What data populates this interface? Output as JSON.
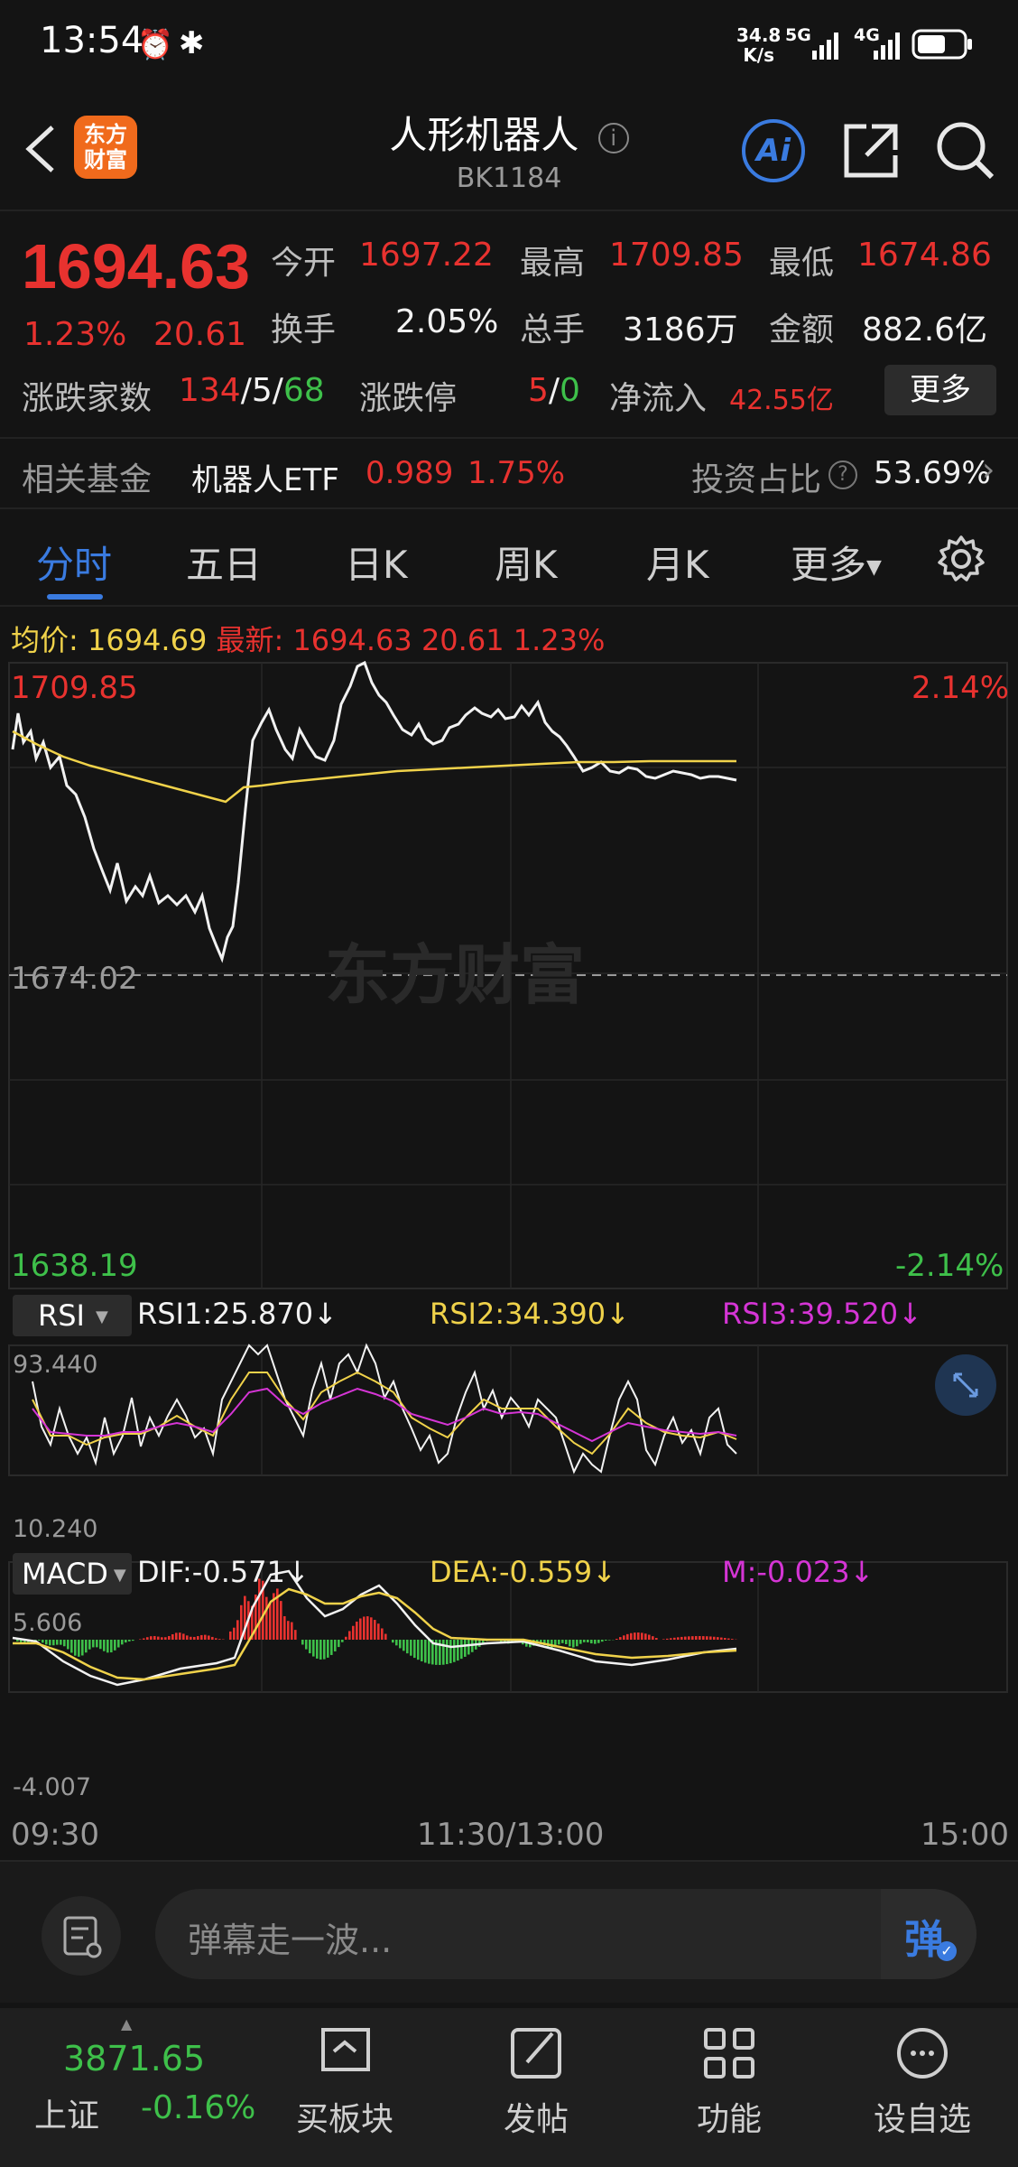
{
  "status_bar": {
    "time": "13:54",
    "speed_value": "34.8",
    "speed_unit": "K/s",
    "network1": "5G",
    "network2": "4G"
  },
  "header": {
    "logo_text_line1": "东方",
    "logo_text_line2": "财富",
    "title": "人形机器人",
    "code": "BK1184",
    "ai_label": "Ai"
  },
  "quote": {
    "price": "1694.63",
    "change_pct": "1.23%",
    "change_amt": "20.61",
    "open_label": "今开",
    "open_value": "1697.22",
    "high_label": "最高",
    "high_value": "1709.85",
    "low_label": "最低",
    "low_value": "1674.86",
    "turnover_label": "换手",
    "turnover_value": "2.05%",
    "volume_label": "总手",
    "volume_value": "3186万",
    "amount_label": "金额",
    "amount_value": "882.6亿",
    "updown_label": "涨跌家数",
    "up_count": "134",
    "flat_count": "5",
    "down_count": "68",
    "limit_label": "涨跌停",
    "limit_up": "5",
    "limit_down": "0",
    "inflow_label": "净流入",
    "inflow_value": "42.55亿",
    "more_button": "更多"
  },
  "fund": {
    "label": "相关基金",
    "name": "机器人ETF",
    "price": "0.989",
    "change": "1.75%",
    "ratio_label": "投资占比",
    "ratio_value": "53.69%"
  },
  "tabs": [
    "分时",
    "五日",
    "日K",
    "周K",
    "月K",
    "更多"
  ],
  "chart_info": {
    "avg_label": "均价:",
    "avg_value": "1694.69",
    "latest_label": "最新:",
    "latest_value": "1694.63",
    "latest_change": "20.61",
    "latest_pct": "1.23%",
    "y_top": "1709.85",
    "y_mid": "1674.02",
    "y_bottom": "1638.19",
    "pct_top": "2.14%",
    "pct_bottom": "-2.14%",
    "watermark": "东方财富"
  },
  "rsi": {
    "selector": "RSI",
    "rsi1": "RSI1:25.870↓",
    "rsi2": "RSI2:34.390↓",
    "rsi3": "RSI3:39.520↓",
    "y_top": "93.440",
    "y_bottom": "10.240"
  },
  "macd": {
    "selector": "MACD",
    "dif": "DIF:-0.571↓",
    "dea": "DEA:-0.559↓",
    "m": "M:-0.023↓",
    "y_top": "5.606",
    "y_bottom": "-4.007"
  },
  "time_axis": {
    "start": "09:30",
    "mid": "11:30/13:00",
    "end": "15:00"
  },
  "comment": {
    "placeholder": "弹幕走一波...",
    "danmu_label": "弹"
  },
  "bottom_nav": {
    "index_value": "3871.65",
    "index_name": "上证",
    "index_change": "-0.16%",
    "items": [
      "买板块",
      "发帖",
      "功能",
      "设自选"
    ]
  },
  "colors": {
    "up": "#e8322f",
    "down": "#3ec04a",
    "accent": "#3a7be0",
    "avg_line": "#f0d24a"
  }
}
